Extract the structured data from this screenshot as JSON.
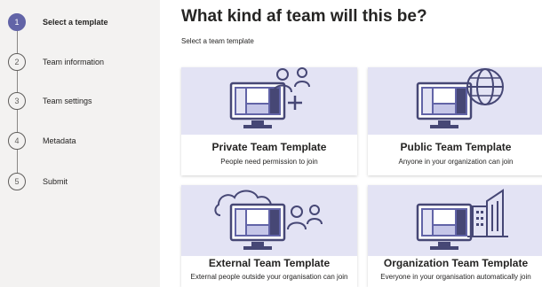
{
  "steps": [
    {
      "number": "1",
      "label": "Select a template",
      "active": true
    },
    {
      "number": "2",
      "label": "Team information",
      "active": false
    },
    {
      "number": "3",
      "label": "Team settings",
      "active": false
    },
    {
      "number": "4",
      "label": "Metadata",
      "active": false
    },
    {
      "number": "5",
      "label": "Submit",
      "active": false
    }
  ],
  "header": {
    "title": "What kind af team will this be?",
    "subtitle": "Select a team template"
  },
  "templates": [
    {
      "title": "Private Team Template",
      "description": "People need permission to join",
      "icon": "people-plus-icon"
    },
    {
      "title": "Public Team Template",
      "description": "Anyone in your organization can join",
      "icon": "globe-icon"
    },
    {
      "title": "External Team Template",
      "description": "External people outside your organisation can join",
      "icon": "cloud-people-icon"
    },
    {
      "title": "Organization Team Template",
      "description": "Everyone in your organisation automatically join",
      "icon": "building-icon"
    }
  ],
  "colors": {
    "accent": "#6264a7",
    "art_background": "#e3e3f4",
    "sidebar_background": "#f3f2f1"
  }
}
